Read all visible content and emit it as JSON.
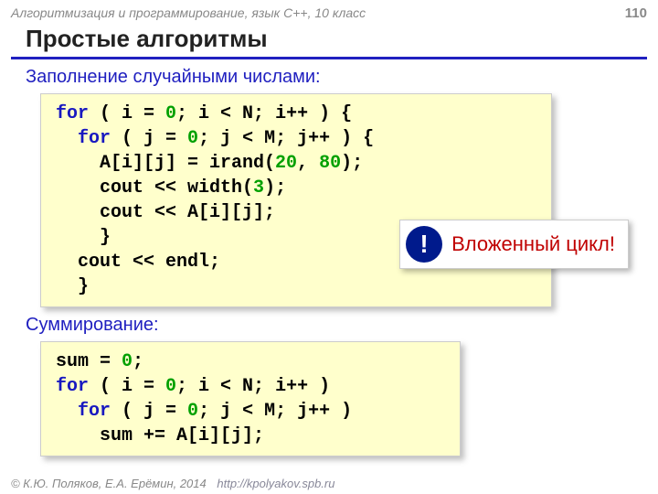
{
  "header": {
    "course": "Алгоритмизация и программирование, язык C++, 10 класс",
    "page": "110"
  },
  "title": "Простые алгоритмы",
  "section1": {
    "heading": "Заполнение случайными числами:",
    "code": {
      "l1a": "for",
      "l1b": " ( i = ",
      "l1c": "0",
      "l1d": "; i < N; i++ ) {",
      "l2a": "for",
      "l2b": " ( j = ",
      "l2c": "0",
      "l2d": "; j < M; j++ ) {",
      "l3a": "A[i][j] = irand(",
      "l3b": "20",
      "l3c": ", ",
      "l3d": "80",
      "l3e": ");",
      "l4": "cout << width(",
      "l4b": "3",
      "l4c": ");",
      "l5": "cout << A[i][j];",
      "l6": "}",
      "l7": "cout << endl;",
      "l8": "}"
    }
  },
  "callout": {
    "badge": "!",
    "text": "Вложенный цикл!"
  },
  "section2": {
    "heading": "Суммирование:",
    "code": {
      "l1a": "sum = ",
      "l1b": "0",
      "l1c": ";",
      "l2a": "for",
      "l2b": " ( i = ",
      "l2c": "0",
      "l2d": "; i < N; i++ )",
      "l3a": "for",
      "l3b": " ( j = ",
      "l3c": "0",
      "l3d": "; j < M; j++ )",
      "l4": "sum += A[i][j];"
    }
  },
  "footer": {
    "copy": "© К.Ю. Поляков, Е.А. Ерёмин, 2014",
    "url": "http://kpolyakov.spb.ru"
  }
}
